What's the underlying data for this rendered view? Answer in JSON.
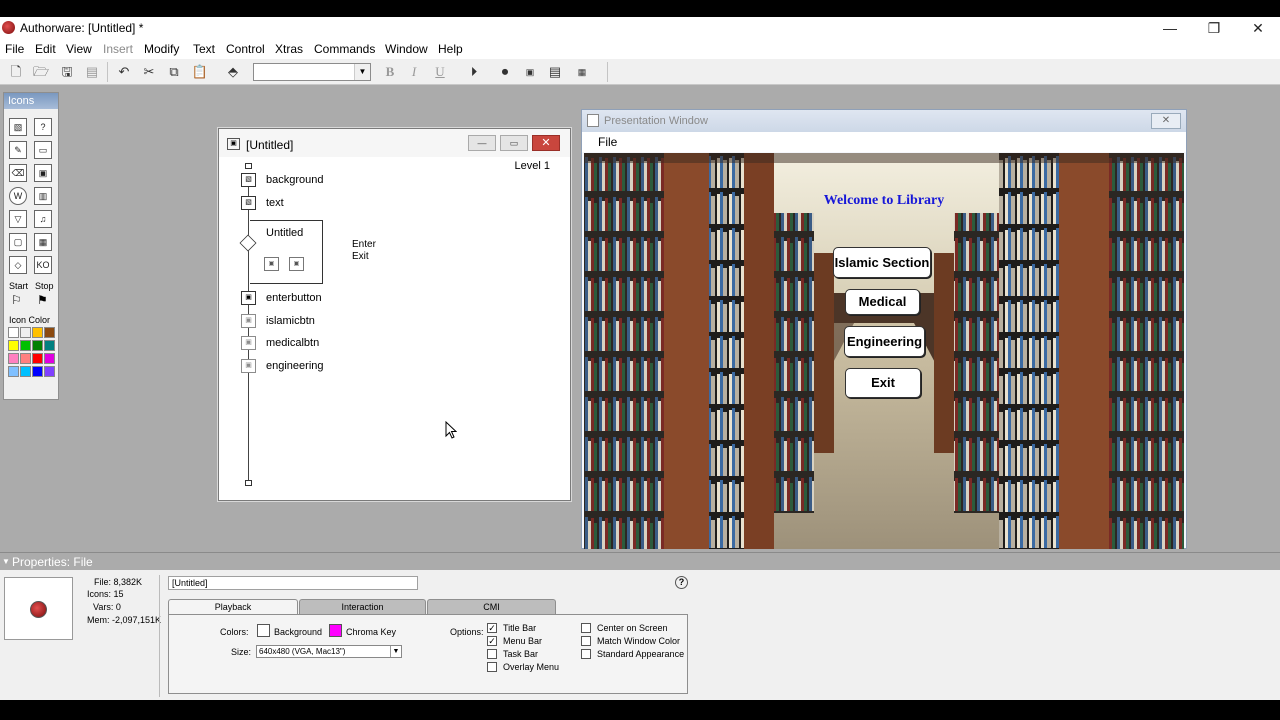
{
  "app": {
    "title": "Authorware: [Untitled] *",
    "window_controls": {
      "minimize": "—",
      "restore": "❐",
      "close": "✕"
    }
  },
  "menu": [
    {
      "label": "File",
      "enabled": true
    },
    {
      "label": "Edit",
      "enabled": true
    },
    {
      "label": "View",
      "enabled": true
    },
    {
      "label": "Insert",
      "enabled": false
    },
    {
      "label": "Modify",
      "enabled": true
    },
    {
      "label": "Text",
      "enabled": true
    },
    {
      "label": "Control",
      "enabled": true
    },
    {
      "label": "Xtras",
      "enabled": true
    },
    {
      "label": "Commands",
      "enabled": true
    },
    {
      "label": "Window",
      "enabled": true
    },
    {
      "label": "Help",
      "enabled": true
    }
  ],
  "toolbar": {
    "bold": "B",
    "italic": "I",
    "underline": "U",
    "font_value": ""
  },
  "palette": {
    "title": "Icons",
    "start_label": "Start",
    "stop_label": "Stop",
    "icon_color_label": "Icon Color",
    "swatch_colors": [
      "#ffffff",
      "#f0f0f0",
      "#ffc000",
      "#8b4a10",
      "#ffff00",
      "#00c000",
      "#008000",
      "#008080",
      "#ff80c0",
      "#ff8080",
      "#ff0000",
      "#e000e0",
      "#80c0ff",
      "#00c0ff",
      "#0000ff",
      "#8040ff"
    ]
  },
  "flow_window": {
    "title": "[Untitled]",
    "level": "Level 1",
    "icons": [
      {
        "label": "background",
        "type": "display",
        "dim": false
      },
      {
        "label": "text",
        "type": "display",
        "dim": false
      },
      {
        "label": "Untitled",
        "type": "interaction",
        "dim": false
      },
      {
        "label": "enterbutton",
        "type": "map",
        "dim": false
      },
      {
        "label": "islamicbtn",
        "type": "map",
        "dim": true
      },
      {
        "label": "medicalbtn",
        "type": "map",
        "dim": true
      },
      {
        "label": "engineering",
        "type": "map",
        "dim": true
      }
    ],
    "responses": [
      "Enter",
      "Exit"
    ]
  },
  "presentation": {
    "title": "Presentation Window",
    "menu_file": "File",
    "welcome": "Welcome to Library",
    "buttons": [
      "Islamic Section",
      "Medical",
      "Engineering",
      "Exit"
    ]
  },
  "properties": {
    "header": "Properties: File",
    "stats": {
      "file": "File: 8,382K",
      "icons": "Icons: 15",
      "vars": "Vars: 0",
      "mem": "Mem: -2,097,151K"
    },
    "name": "[Untitled]",
    "tabs": [
      "Playback",
      "Interaction",
      "CMI"
    ],
    "colors_label": "Colors:",
    "background_label": "Background",
    "background_color": "#ffffff",
    "chroma_label": "Chroma Key",
    "chroma_color": "#ff00ff",
    "size_label": "Size:",
    "size_value": "640x480 (VGA, Mac13\")",
    "options_label": "Options:",
    "options_left": [
      {
        "label": "Title Bar",
        "checked": true
      },
      {
        "label": "Menu Bar",
        "checked": true
      },
      {
        "label": "Task Bar",
        "checked": false
      },
      {
        "label": "Overlay Menu",
        "checked": false
      }
    ],
    "options_right": [
      {
        "label": "Center on Screen",
        "checked": false
      },
      {
        "label": "Match Window Color",
        "checked": false
      },
      {
        "label": "Standard Appearance",
        "checked": false
      }
    ]
  }
}
